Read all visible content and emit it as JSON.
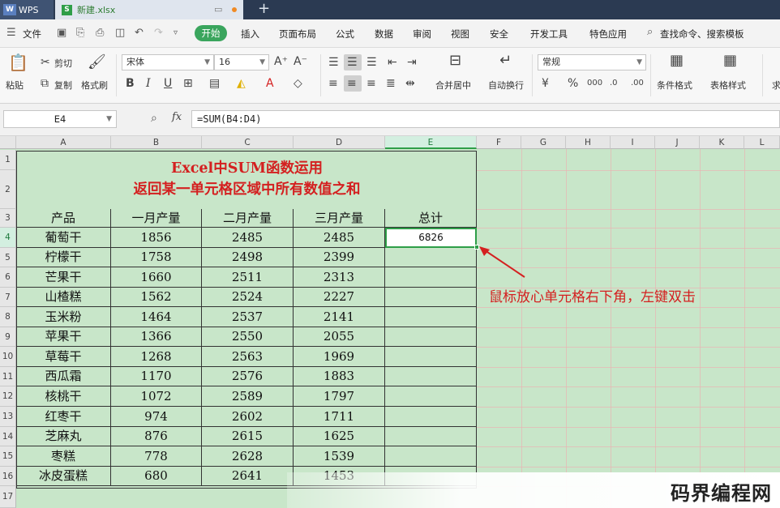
{
  "titlebar": {
    "app_tab": "WPS",
    "file_tab": "新建.xlsx"
  },
  "menu": {
    "file": "文件",
    "start": "开始",
    "items": [
      "插入",
      "页面布局",
      "公式",
      "数据",
      "审阅",
      "视图",
      "安全",
      "开发工具",
      "特色应用"
    ],
    "search": "查找命令、搜索模板"
  },
  "toolbar": {
    "paste": "粘贴",
    "cut": "剪切",
    "copy": "复制",
    "format_painter": "格式刷",
    "font_name": "宋体",
    "font_size": "16",
    "merge_center": "合并居中",
    "wrap": "自动换行",
    "number_format": "常规",
    "cond_format": "条件格式",
    "table_style": "表格样式",
    "more": "求"
  },
  "formula_bar": {
    "cell_ref": "E4",
    "fx": "fx",
    "formula": "=SUM(B4:D4)"
  },
  "columns": [
    "A",
    "B",
    "C",
    "D",
    "E",
    "F",
    "G",
    "H",
    "I",
    "J",
    "K",
    "L"
  ],
  "rows": [
    "1",
    "2",
    "3",
    "4",
    "5",
    "6",
    "7",
    "8",
    "9",
    "10",
    "11",
    "12",
    "13",
    "14",
    "15",
    "16",
    "17"
  ],
  "sheet": {
    "title_line1": "Excel中SUM函数运用",
    "title_line2": "返回某一单元格区域中所有数值之和",
    "headers": [
      "产品",
      "一月产量",
      "二月产量",
      "三月产量",
      "总计"
    ],
    "data": [
      [
        "葡萄干",
        "1856",
        "2485",
        "2485",
        "6826"
      ],
      [
        "柠檬干",
        "1758",
        "2498",
        "2399",
        ""
      ],
      [
        "芒果干",
        "1660",
        "2511",
        "2313",
        ""
      ],
      [
        "山楂糕",
        "1562",
        "2524",
        "2227",
        ""
      ],
      [
        "玉米粉",
        "1464",
        "2537",
        "2141",
        ""
      ],
      [
        "苹果干",
        "1366",
        "2550",
        "2055",
        ""
      ],
      [
        "草莓干",
        "1268",
        "2563",
        "1969",
        ""
      ],
      [
        "西瓜霜",
        "1170",
        "2576",
        "1883",
        ""
      ],
      [
        "核桃干",
        "1072",
        "2589",
        "1797",
        ""
      ],
      [
        "红枣干",
        "974",
        "2602",
        "1711",
        ""
      ],
      [
        "芝麻丸",
        "876",
        "2615",
        "1625",
        ""
      ],
      [
        "枣糕",
        "778",
        "2628",
        "1539",
        ""
      ],
      [
        "冰皮蛋糕",
        "680",
        "2641",
        "1453",
        ""
      ]
    ]
  },
  "annotation": "鼠标放心单元格右下角，左键双击",
  "watermark": "码界编程网",
  "colors": {
    "accent": "#2e9e48",
    "title_red": "#d42020",
    "sheet_bg": "#c8e6c9"
  }
}
